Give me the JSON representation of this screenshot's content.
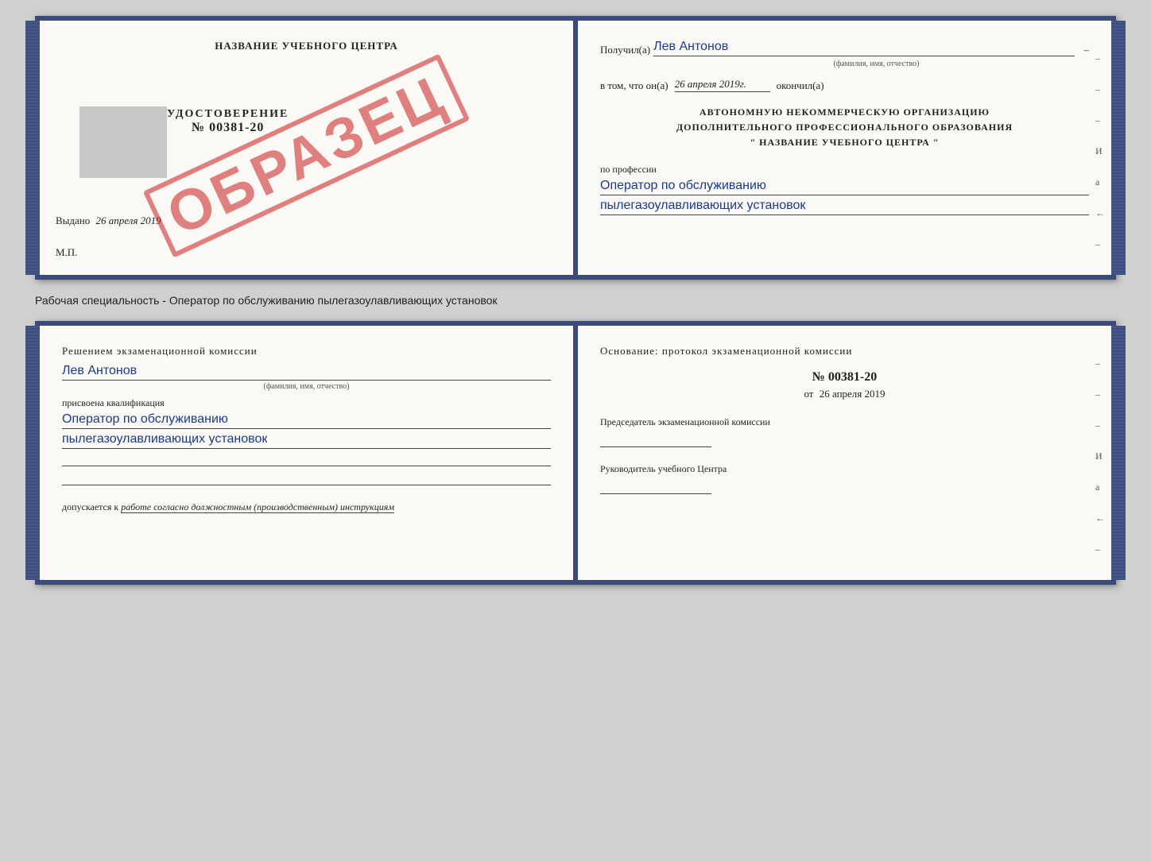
{
  "top_cert": {
    "left": {
      "school_name": "НАЗВАНИЕ УЧЕБНОГО ЦЕНТРА",
      "udostoverenie_label": "УДОСТОВЕРЕНИЕ",
      "number": "№ 00381-20",
      "vydano_label": "Выдано",
      "vydano_date": "26 апреля 2019",
      "mp_label": "М.П.",
      "stamp": "ОБРАЗЕЦ"
    },
    "right": {
      "poluchil_label": "Получил(а)",
      "poluchil_name": "Лев Антонов",
      "fio_subtitle": "(фамилия, имя, отчество)",
      "vtom_label": "в том, что он(а)",
      "vtom_date": "26 апреля 2019г.",
      "okonchil_label": "окончил(а)",
      "org_line1": "АВТОНОМНУЮ НЕКОММЕРЧЕСКУЮ ОРГАНИЗАЦИЮ",
      "org_line2": "ДОПОЛНИТЕЛЬНОГО ПРОФЕССИОНАЛЬНОГО ОБРАЗОВАНИЯ",
      "org_line3": "\" НАЗВАНИЕ УЧЕБНОГО ЦЕНТРА \"",
      "professiya_label": "по профессии",
      "professiya_line1": "Оператор по обслуживанию",
      "professiya_line2": "пылегазоулавливающих установок"
    }
  },
  "separator": {
    "text": "Рабочая специальность - Оператор по обслуживанию пылегазоулавливающих установок"
  },
  "bottom_cert": {
    "left": {
      "resheniem_label": "Решением экзаменационной комиссии",
      "person_name": "Лев Антонов",
      "fio_subtitle": "(фамилия, имя, отчество)",
      "prisvoena_label": "присвоена квалификация",
      "kvalif_line1": "Оператор по обслуживанию",
      "kvalif_line2": "пылегазоулавливающих установок",
      "dopuskaetsya_label": "допускается к",
      "dopuskaetsya_text": "работе согласно должностным (производственным) инструкциям"
    },
    "right": {
      "osnovanie_label": "Основание: протокол экзаменационной комиссии",
      "protocol_number": "№ 00381-20",
      "protocol_date_prefix": "от",
      "protocol_date": "26 апреля 2019",
      "predsedatel_label": "Председатель экзаменационной комиссии",
      "rukovoditel_label": "Руководитель учебного Центра"
    }
  },
  "margin_marks": [
    "-",
    "-",
    "-",
    "И",
    "а",
    "←",
    "-",
    "-"
  ]
}
